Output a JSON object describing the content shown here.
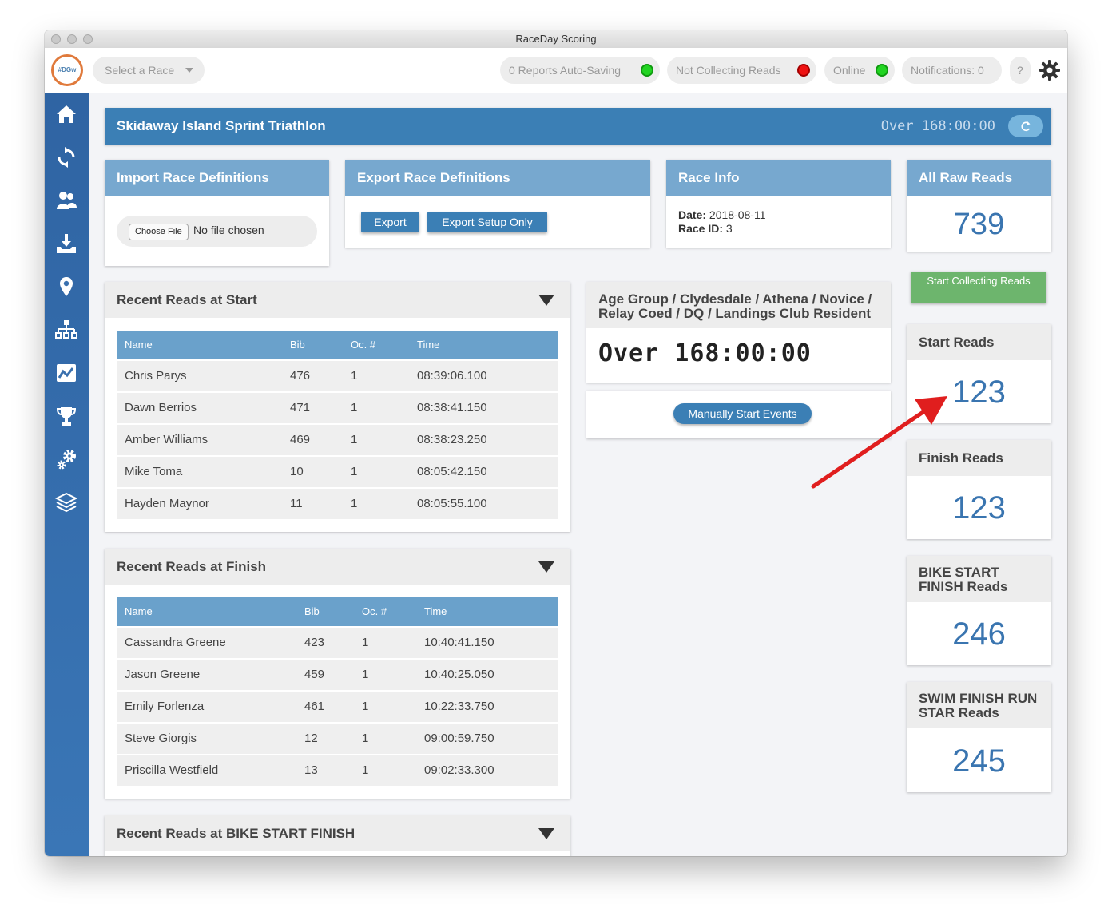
{
  "window": {
    "title": "RaceDay Scoring"
  },
  "topbar": {
    "logo_text": "#DGw",
    "race_select_placeholder": "Select a Race",
    "status_autosave": "0 Reports Auto-Saving",
    "status_collecting": "Not Collecting Reads",
    "status_online": "Online",
    "notifications": "Notifications: 0",
    "help": "?"
  },
  "sidebar": {
    "items": [
      "home-icon",
      "sync-icon",
      "people-icon",
      "download-tray-icon",
      "map-pin-icon",
      "hierarchy-icon",
      "chart-icon",
      "trophy-icon",
      "gears-icon",
      "layers-icon"
    ]
  },
  "banner": {
    "title": "Skidaway Island Sprint Triathlon",
    "time": "Over 168:00:00"
  },
  "import_card": {
    "title": "Import Race Definitions",
    "choose_file": "Choose File",
    "no_file": "No file chosen"
  },
  "export_card": {
    "title": "Export Race Definitions",
    "export": "Export",
    "export_setup": "Export Setup Only"
  },
  "race_info": {
    "title": "Race Info",
    "date_label": "Date:",
    "date_value": "2018-08-11",
    "id_label": "Race ID:",
    "id_value": "3"
  },
  "raw_reads": {
    "title": "All Raw Reads",
    "count": "739"
  },
  "start_collecting_button": "Start Collecting Reads",
  "start_reads": {
    "title": "Start Reads",
    "count": "123"
  },
  "finish_reads": {
    "title": "Finish Reads",
    "count": "123"
  },
  "bike_reads": {
    "title_line1": "BIKE START",
    "title_line2": "FINISH Reads",
    "count": "246"
  },
  "swim_reads": {
    "title_line1": "SWIM FINISH RUN",
    "title_line2": "STAR Reads",
    "count": "245"
  },
  "age_group": {
    "title_line1": "Age Group / Clydesdale / Athena / Novice /",
    "title_line2": "Relay Coed / DQ / Landings Club Resident",
    "time": "Over 168:00:00",
    "manual_button": "Manually Start Events"
  },
  "columns": {
    "name": "Name",
    "bib": "Bib",
    "oc": "Oc. #",
    "time": "Time"
  },
  "recent_start": {
    "title": "Recent Reads at Start",
    "rows": [
      {
        "name": "Chris Parys",
        "bib": "476",
        "oc": "1",
        "time": "08:39:06.100"
      },
      {
        "name": "Dawn Berrios",
        "bib": "471",
        "oc": "1",
        "time": "08:38:41.150"
      },
      {
        "name": "Amber Williams",
        "bib": "469",
        "oc": "1",
        "time": "08:38:23.250"
      },
      {
        "name": "Mike Toma",
        "bib": "10",
        "oc": "1",
        "time": "08:05:42.150"
      },
      {
        "name": "Hayden Maynor",
        "bib": "11",
        "oc": "1",
        "time": "08:05:55.100"
      }
    ]
  },
  "recent_finish": {
    "title": "Recent Reads at Finish",
    "rows": [
      {
        "name": "Cassandra Greene",
        "bib": "423",
        "oc": "1",
        "time": "10:40:41.150"
      },
      {
        "name": "Jason Greene",
        "bib": "459",
        "oc": "1",
        "time": "10:40:25.050"
      },
      {
        "name": "Emily Forlenza",
        "bib": "461",
        "oc": "1",
        "time": "10:22:33.750"
      },
      {
        "name": "Steve Giorgis",
        "bib": "12",
        "oc": "1",
        "time": "09:00:59.750"
      },
      {
        "name": "Priscilla Westfield",
        "bib": "13",
        "oc": "1",
        "time": "09:02:33.300"
      }
    ]
  },
  "recent_bike": {
    "title": "Recent Reads at BIKE START FINISH"
  },
  "colors": {
    "primary": "#3b7fb5",
    "card_header": "#77a8cf",
    "success": "#6db56d",
    "annotation_arrow": "#e01e1e"
  }
}
